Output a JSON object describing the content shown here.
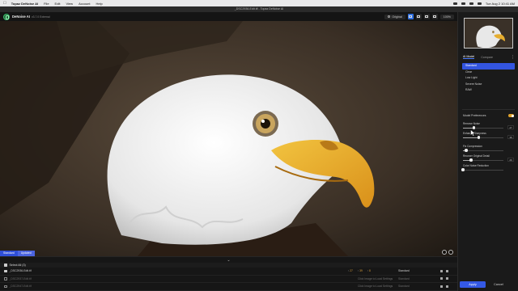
{
  "menubar": {
    "app": "Topaz DeNoise AI",
    "items": [
      "File",
      "Edit",
      "View",
      "Account",
      "Help"
    ],
    "clock": "Tue Aug 2  10:41 AM"
  },
  "window": {
    "title": "_DSC2936-Edit.tif - Topaz DeNoise AI"
  },
  "toolbar": {
    "app_name": "DeNoise AI",
    "version": "v3.7.0 External",
    "original_label": "Original",
    "zoom_label": "100%"
  },
  "preview": {
    "model_tag": "Standard",
    "status_tag": "Updated"
  },
  "filepanel": {
    "select_all": "Select All (3)",
    "rows": [
      {
        "name": "_DSC2936-Edit.tif",
        "v1": "27",
        "v2": "39",
        "v3": "8",
        "model": "Standard",
        "hint": ""
      },
      {
        "name": "_DSC2937-Edit.tif",
        "hint": "Click Image to Load Settings",
        "model": "Standard"
      },
      {
        "name": "_DSC2947-Edit.tif",
        "hint": "Click Image to Load Settings",
        "model": "Standard"
      }
    ]
  },
  "rightpanel": {
    "tab_ai_model": "AI Model",
    "tab_compare": "Compare",
    "more_icon": "⋮",
    "models": [
      "Standard",
      "Clear",
      "Low Light",
      "Severe Noise",
      "RAW"
    ],
    "model_preferences": "Model Preferences",
    "sliders": [
      {
        "label": "Remove Noise",
        "value": "27",
        "fraction": 0.27
      },
      {
        "label": "Enhance Sharpness",
        "value": "39",
        "fraction": 0.39
      },
      {
        "label": "Fix Compression",
        "value": "8",
        "fraction": 0.08
      },
      {
        "label": "Recover Original Detail",
        "value": "20",
        "fraction": 0.2
      },
      {
        "label": "Color Noise Reduction",
        "value": "0",
        "fraction": 0.0
      }
    ],
    "apply": "Apply",
    "cancel": "Cancel"
  }
}
